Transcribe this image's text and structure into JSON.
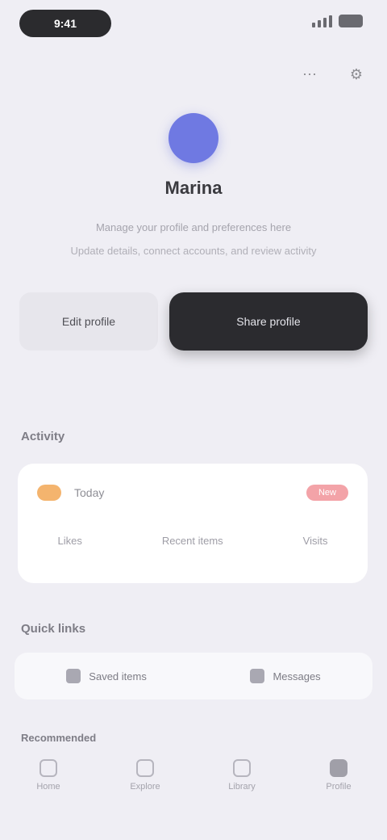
{
  "status": {
    "time": "9:41"
  },
  "header": {
    "icons": [
      "more-icon",
      "settings-icon"
    ]
  },
  "profile": {
    "name": "Marina",
    "description_line1": "Manage your profile and preferences here",
    "description_line2": "Update details, connect accounts, and review activity"
  },
  "actions": {
    "secondary_label": "Edit profile",
    "primary_label": "Share profile"
  },
  "activity": {
    "section_title": "Activity",
    "row_label": "Today",
    "badge": "New",
    "stats": [
      "Likes",
      "Recent items",
      "Visits"
    ]
  },
  "quick": {
    "section_title": "Quick links",
    "items": [
      "Saved items",
      "Messages"
    ]
  },
  "tabs": {
    "section_title": "Recommended",
    "items": [
      "Home",
      "Explore",
      "Library",
      "Profile"
    ]
  },
  "colors": {
    "accent": "#6f79e2",
    "primary_button": "#2b2b2f",
    "badge": "#f3a3a8",
    "indicator": "#f4b46e"
  }
}
